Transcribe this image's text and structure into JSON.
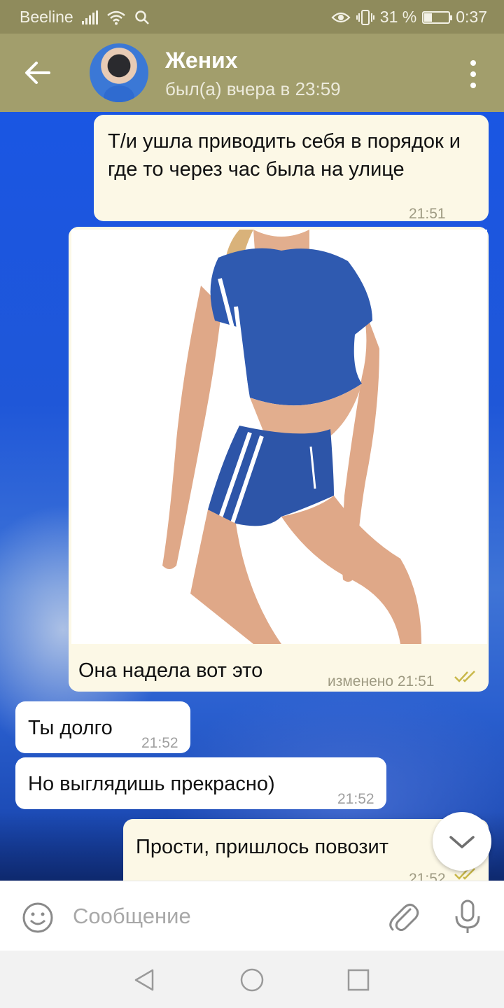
{
  "status_bar": {
    "carrier": "Beeline",
    "battery": "31 %",
    "battery_level": 0.31,
    "time": "0:37",
    "icons": [
      "signal-icon",
      "wifi-icon",
      "search-icon",
      "eye-icon",
      "vibrate-icon",
      "battery-icon"
    ]
  },
  "header": {
    "title": "Жених",
    "subtitle": "был(а) вчера в 23:59",
    "icons": [
      "back-arrow-icon",
      "avatar",
      "more-vert-icon"
    ]
  },
  "messages": [
    {
      "direction": "out",
      "text": "Т/и ушла приводить себя в порядок и где то через час была на улице",
      "time": "21:51",
      "status": "read"
    },
    {
      "direction": "out",
      "type": "photo",
      "caption": "Она надела вот это",
      "edited_label": "изменено",
      "time": "21:51",
      "status": "read"
    },
    {
      "direction": "in",
      "text": "Ты долго",
      "time": "21:52"
    },
    {
      "direction": "in",
      "text": "Но выглядишь прекрасно)",
      "time": "21:52"
    },
    {
      "direction": "out",
      "text": "Прости, пришлось повозит",
      "time": "21:52",
      "status": "read"
    }
  ],
  "input": {
    "placeholder": "Сообщение",
    "icons": [
      "emoji-icon",
      "attach-icon",
      "mic-icon"
    ]
  },
  "navigation": {
    "icons": [
      "nav-back-icon",
      "nav-home-icon",
      "nav-recents-icon"
    ]
  },
  "colors": {
    "header": "#a29e6c",
    "status_bar": "#8f8b5c",
    "outgoing_bubble": "#fcf8e6",
    "incoming_bubble": "#ffffff",
    "read_ticks": "#c9b84a"
  }
}
